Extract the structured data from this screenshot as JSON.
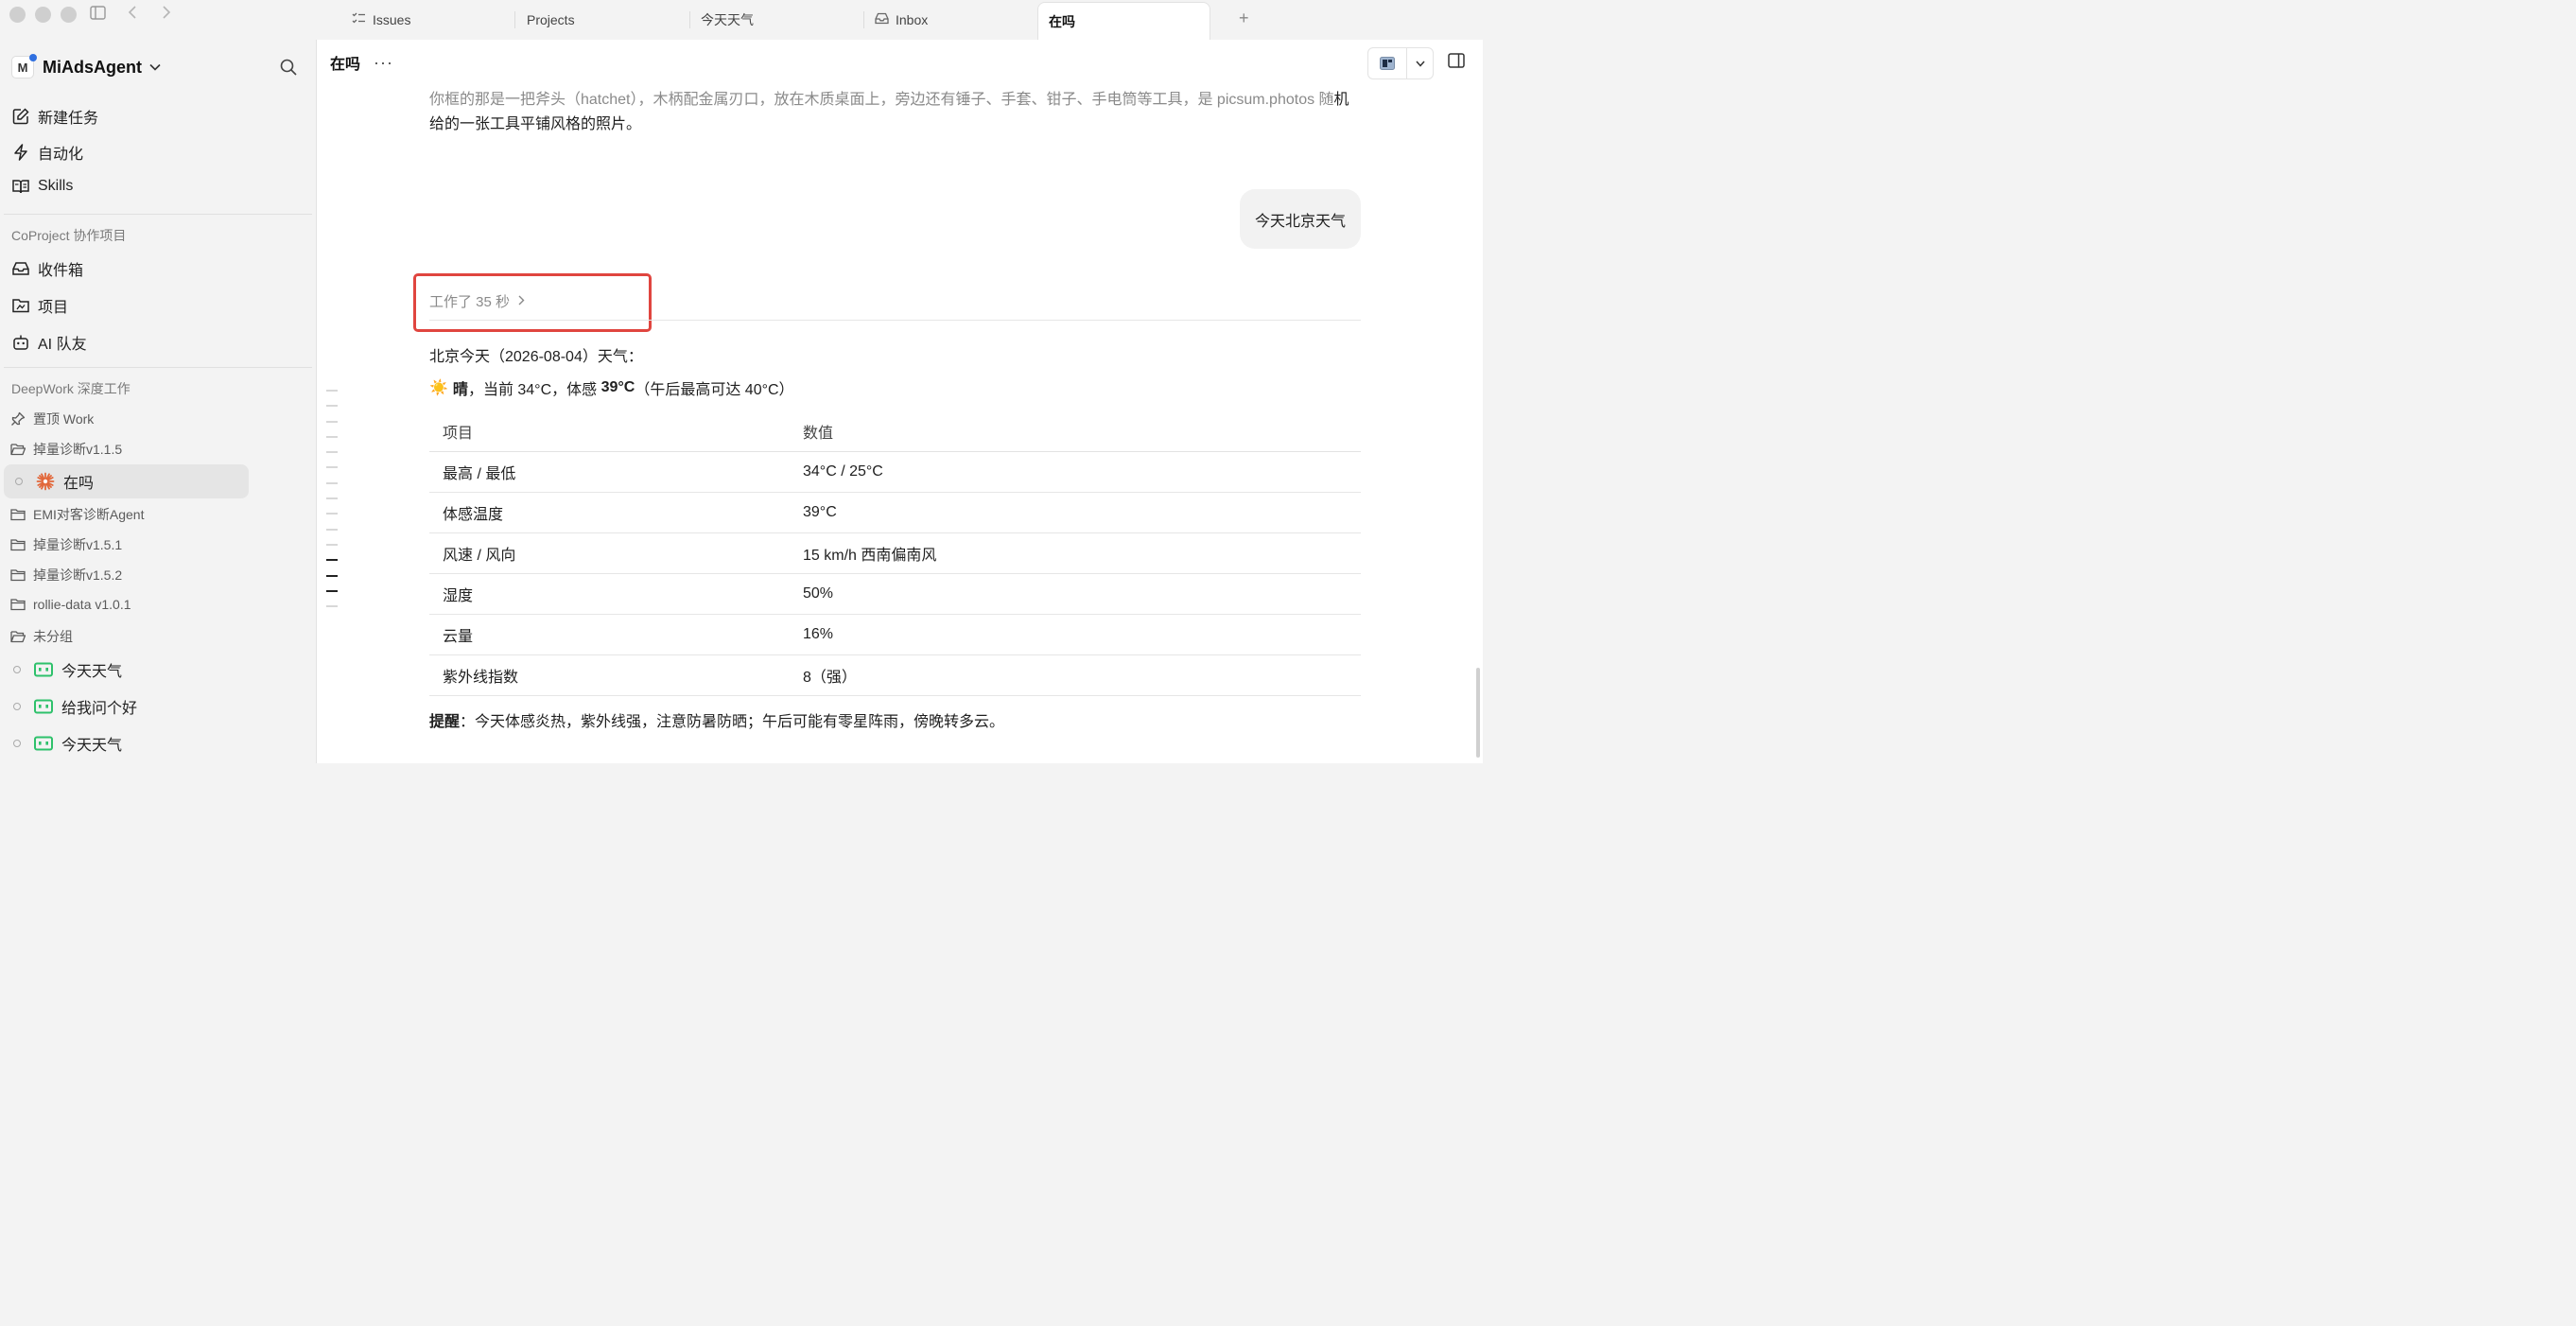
{
  "topbar": {
    "tabs": [
      {
        "label": "Issues",
        "icon": "list-check-icon"
      },
      {
        "label": "Projects",
        "icon": ""
      },
      {
        "label": "今天天气",
        "icon": ""
      },
      {
        "label": "Inbox",
        "icon": "inbox-icon"
      },
      {
        "label": "在吗",
        "icon": "",
        "active": true
      }
    ],
    "new_tab": "+"
  },
  "sidebar": {
    "workspace": {
      "initial": "M",
      "name": "MiAdsAgent"
    },
    "nav": [
      {
        "label": "新建任务",
        "icon": "edit-icon"
      },
      {
        "label": "自动化",
        "icon": "lightning-icon"
      },
      {
        "label": "Skills",
        "icon": "book-icon"
      }
    ],
    "coproject": {
      "title": "CoProject 协作项目",
      "items": [
        {
          "label": "收件箱",
          "icon": "inbox-icon"
        },
        {
          "label": "项目",
          "icon": "project-folder-icon"
        },
        {
          "label": "AI 队友",
          "icon": "robot-icon"
        }
      ]
    },
    "deepwork": {
      "title": "DeepWork 深度工作",
      "pinned": "置顶 Work",
      "group1": "掉量诊断v1.1.5",
      "selected_task": "在吗",
      "folders": [
        "EMI对客诊断Agent",
        "掉量诊断v1.5.1",
        "掉量诊断v1.5.2",
        "rollie-data v1.0.1"
      ],
      "ungrouped": "未分组",
      "tasks": [
        "今天天气",
        "给我问个好",
        "今天天气"
      ]
    }
  },
  "main": {
    "title": "在吗",
    "more": "···",
    "para_gray": "你框的那是一把斧头（hatchet），木柄配金属刃口，放在木质桌面上，旁边还有锤子、手套、钳子、手电筒等工具，是 picsum.photos 随",
    "para_dark": "机给的一张工具平铺风格的照片。",
    "user_message": "今天北京天气",
    "worked": "工作了 35 秒",
    "weather_intro": "北京今天（2026-08-04）天气：",
    "cond_sun": "☀️",
    "cond_bold": "晴",
    "cond_mid": "，当前 34°C，体感 ",
    "cond_feel": "39°C",
    "cond_tail": "（午后最高可达 40°C）",
    "table": {
      "headers": [
        "项目",
        "数值"
      ],
      "rows": [
        [
          "最高 / 最低",
          "34°C / 25°C"
        ],
        [
          "体感温度",
          "39°C"
        ],
        [
          "风速 / 风向",
          "15 km/h 西南偏南风"
        ],
        [
          "湿度",
          "50%"
        ],
        [
          "云量",
          "16%"
        ],
        [
          "紫外线指数",
          "8（强）"
        ]
      ]
    },
    "note_label": "提醒",
    "note_text": "：今天体感炎热，紫外线强，注意防暑防晒；午后可能有零星阵雨，傍晚转多云。"
  },
  "colors": {
    "highlight_box": "#e0453f",
    "accent_dot": "#2f6fe0",
    "bot_icon": "#2ec16b",
    "spark_icon": "#e2673a"
  }
}
